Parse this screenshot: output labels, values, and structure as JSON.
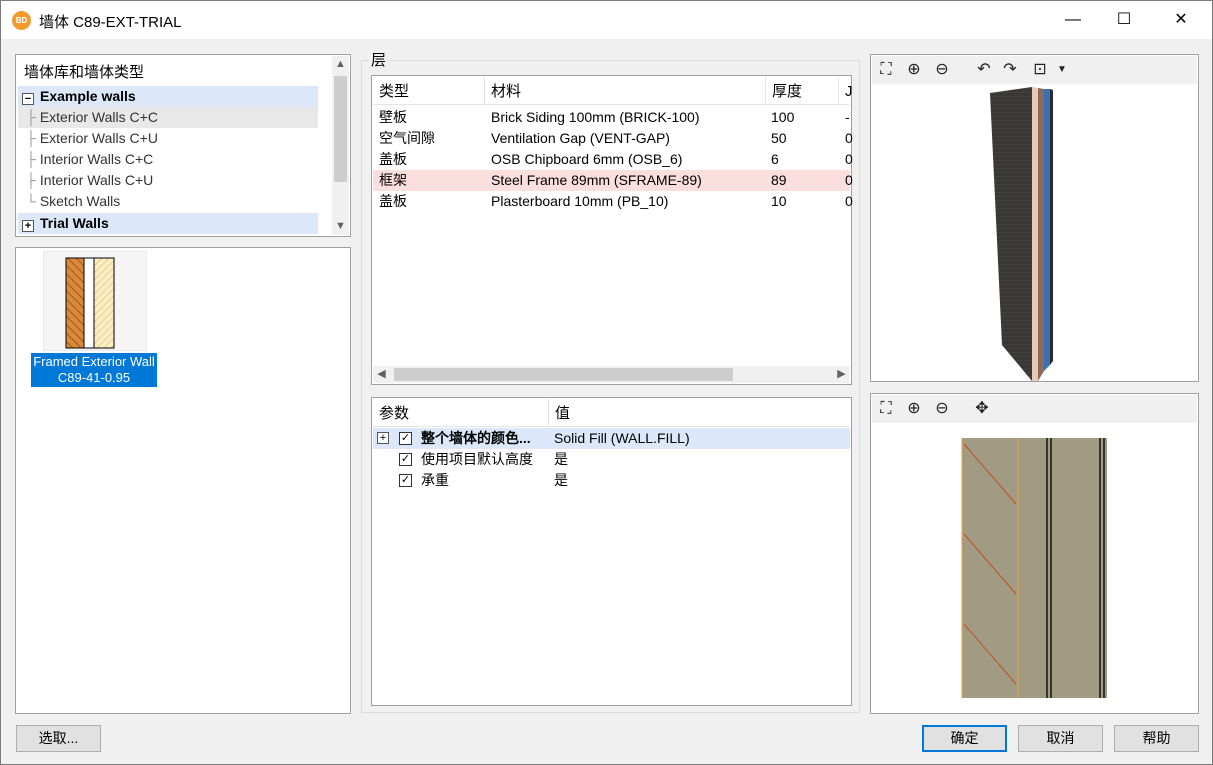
{
  "window": {
    "title": "墙体 C89-EXT-TRIAL",
    "app_icon_text": "BD",
    "minimize": "—",
    "maximize": "☐",
    "close": "✕"
  },
  "library": {
    "header": "墙体库和墙体类型",
    "groups": [
      {
        "label": "Example walls",
        "expander": "−"
      },
      {
        "label": "Trial Walls",
        "expander": "+"
      }
    ],
    "items": [
      "Exterior Walls C+C",
      "Exterior Walls C+U",
      "Interior Walls C+C",
      "Interior Walls C+U",
      "Sketch Walls"
    ]
  },
  "wall_type": {
    "line1": "Framed Exterior Wall",
    "line2": "C89-41-0.95"
  },
  "layers": {
    "group_label": "层",
    "columns": [
      "类型",
      "材料",
      "厚度",
      "J"
    ],
    "rows": [
      {
        "type": "壁板",
        "material": "Brick Siding 100mm (BRICK-100)",
        "thickness": "100",
        "extra": "-"
      },
      {
        "type": "空气间隙",
        "material": "Ventilation Gap (VENT-GAP)",
        "thickness": "50",
        "extra": "0"
      },
      {
        "type": "盖板",
        "material": "OSB Chipboard 6mm (OSB_6)",
        "thickness": "6",
        "extra": "0"
      },
      {
        "type": "框架",
        "material": "Steel Frame 89mm (SFRAME-89)",
        "thickness": "89",
        "extra": "0"
      },
      {
        "type": "盖板",
        "material": "Plasterboard 10mm (PB_10)",
        "thickness": "10",
        "extra": "0"
      }
    ]
  },
  "params": {
    "columns": [
      "参数",
      "值"
    ],
    "rows": [
      {
        "name": "整个墙体的颜色...",
        "value": "Solid Fill  (WALL.FILL)",
        "expander": "+",
        "check": "✓"
      },
      {
        "name": "使用项目默认高度",
        "value": "是",
        "check": "✓"
      },
      {
        "name": "承重",
        "value": "是",
        "check": "✓"
      }
    ]
  },
  "buttons": {
    "select": "选取...",
    "ok": "确定",
    "cancel": "取消",
    "help": "帮助"
  },
  "colors": {
    "selection": "#0078d7",
    "highlight_row": "#fbdede",
    "group_row": "#dce8fa"
  }
}
